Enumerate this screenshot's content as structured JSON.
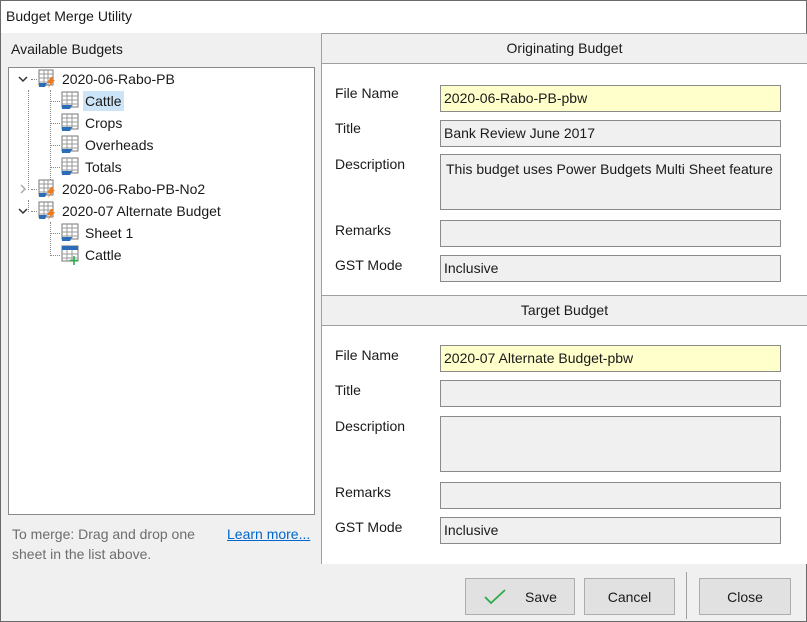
{
  "window": {
    "title": "Budget Merge Utility"
  },
  "left": {
    "title": "Available Budgets",
    "tree": [
      {
        "label": "2020-06-Rabo-PB",
        "level": 0,
        "kind": "budget",
        "expanded": true
      },
      {
        "label": "Cattle",
        "level": 1,
        "kind": "sheet",
        "selected": true
      },
      {
        "label": "Crops",
        "level": 1,
        "kind": "sheet"
      },
      {
        "label": "Overheads",
        "level": 1,
        "kind": "sheet"
      },
      {
        "label": "Totals",
        "level": 1,
        "kind": "sheet"
      },
      {
        "label": "2020-06-Rabo-PB-No2",
        "level": 0,
        "kind": "budget",
        "expanded": false
      },
      {
        "label": "2020-07 Alternate Budget",
        "level": 0,
        "kind": "budget",
        "expanded": true
      },
      {
        "label": "Sheet 1",
        "level": 1,
        "kind": "sheet"
      },
      {
        "label": "Cattle",
        "level": 1,
        "kind": "sheet-new"
      }
    ],
    "hint": "To merge: Drag and drop one sheet in the list above.",
    "learn_more": "Learn more..."
  },
  "originating": {
    "header": "Originating Budget",
    "labels": {
      "file_name": "File Name",
      "title": "Title",
      "description": "Description",
      "remarks": "Remarks",
      "gst_mode": "GST Mode"
    },
    "file_name": "2020-06-Rabo-PB-pbw",
    "title": "Bank Review June 2017",
    "description": "This budget uses Power Budgets Multi Sheet feature",
    "remarks": "",
    "gst_mode": "Inclusive"
  },
  "target": {
    "header": "Target Budget",
    "labels": {
      "file_name": "File Name",
      "title": "Title",
      "description": "Description",
      "remarks": "Remarks",
      "gst_mode": "GST Mode"
    },
    "file_name": "2020-07 Alternate Budget-pbw",
    "title": "",
    "description": "",
    "remarks": "",
    "gst_mode": "Inclusive"
  },
  "footer": {
    "save": "Save",
    "cancel": "Cancel",
    "close": "Close"
  },
  "colors": {
    "selection": "#cce4f7",
    "file_name_bg": "#ffffcc",
    "link": "#0066cc",
    "save_check": "#2eaa4a"
  }
}
